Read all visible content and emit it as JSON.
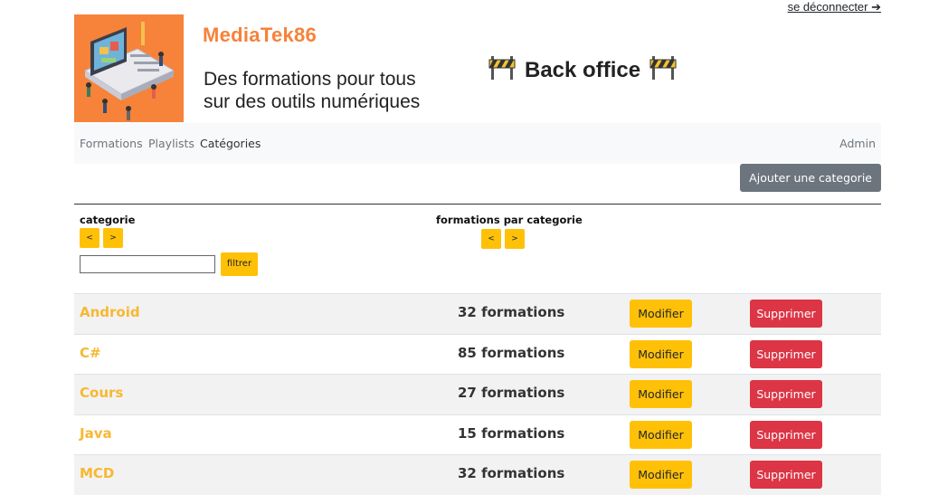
{
  "header": {
    "logout_label": "se déconnecter ➔",
    "brand": "MediaTek86",
    "tagline_line1": "Des formations pour tous",
    "tagline_line2": "sur des outils numériques",
    "section_title": "Back office",
    "accent_color": "#f7823a"
  },
  "nav": {
    "items": [
      {
        "label": "Formations"
      },
      {
        "label": "Playlists"
      },
      {
        "label": "Catégories"
      }
    ],
    "admin_label": "Admin"
  },
  "toolbar": {
    "add_label": "Ajouter une categorie"
  },
  "table": {
    "col_categorie": "categorie",
    "col_formations": "formations par categorie",
    "sort_prev": "<",
    "sort_next": ">",
    "filter_placeholder": "",
    "filter_label": "filtrer",
    "modify_label": "Modifier",
    "delete_label": "Supprimer",
    "rows": [
      {
        "name": "Android",
        "count": "32 formations"
      },
      {
        "name": "C#",
        "count": "85 formations"
      },
      {
        "name": "Cours",
        "count": "27 formations"
      },
      {
        "name": "Java",
        "count": "15 formations"
      },
      {
        "name": "MCD",
        "count": "32 formations"
      }
    ]
  }
}
